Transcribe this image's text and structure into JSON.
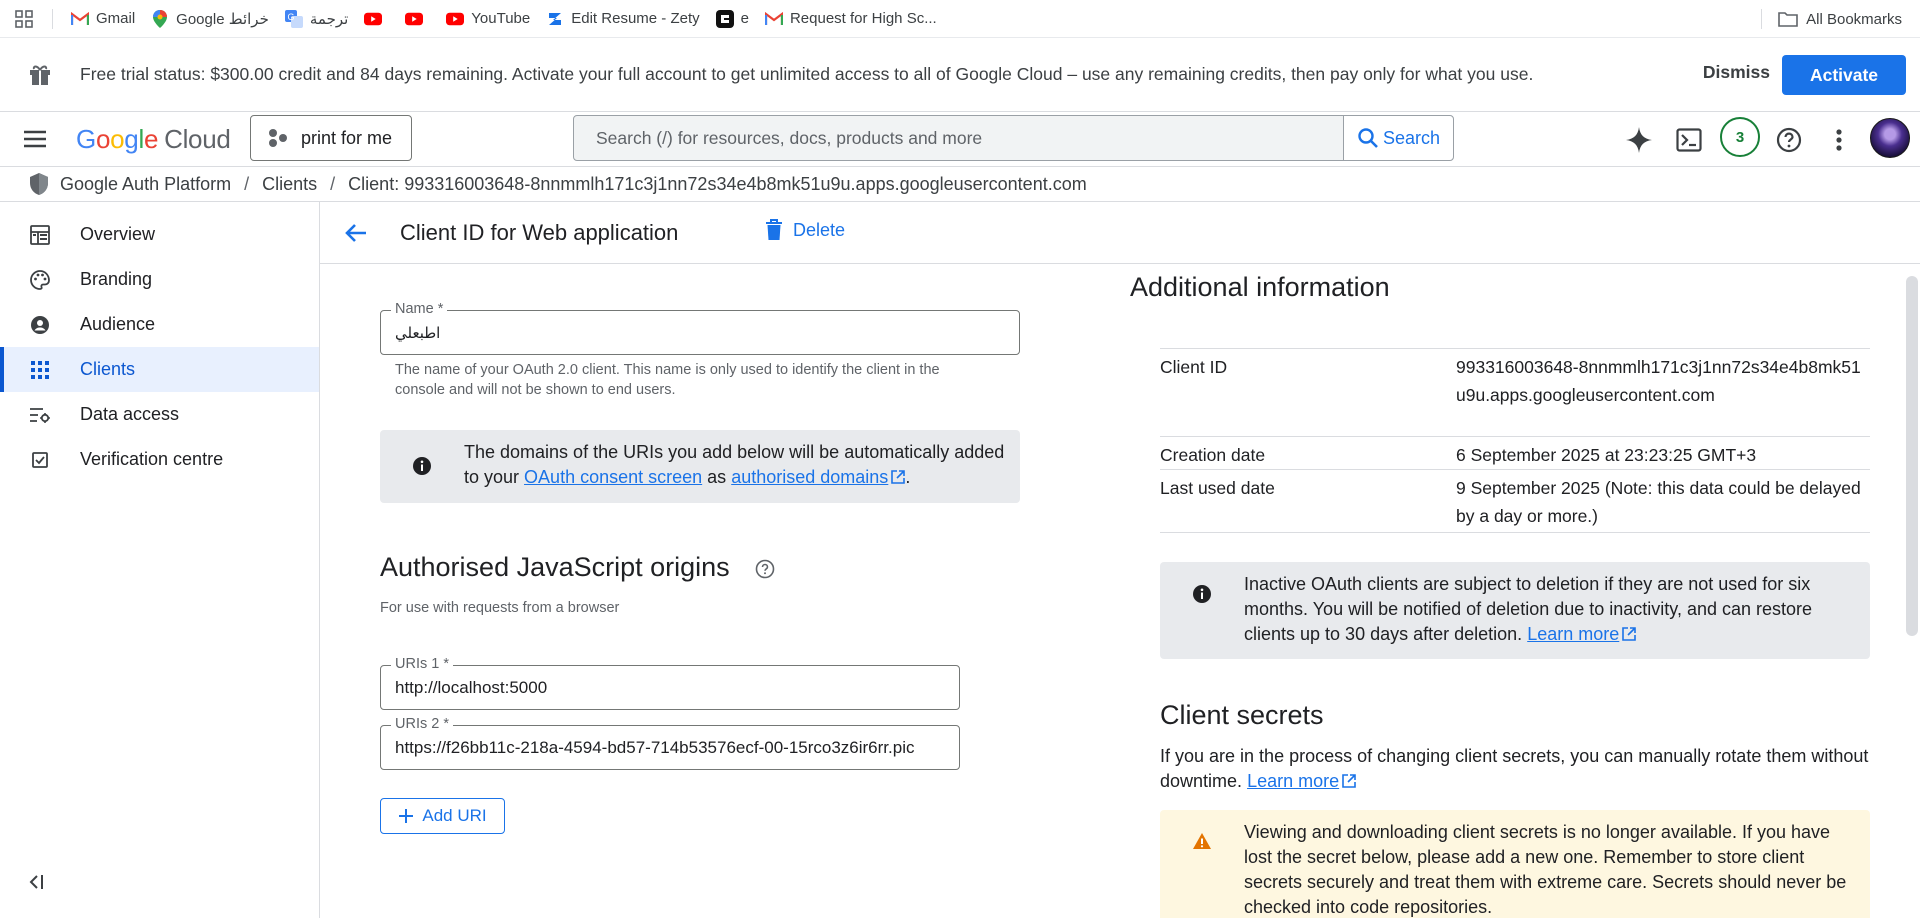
{
  "bookmarks": {
    "items": [
      {
        "label": "Gmail",
        "icon": "gmail-icon"
      },
      {
        "label": "Google خرائط",
        "icon": "maps-icon"
      },
      {
        "label": "ترجمة",
        "icon": "translate-icon"
      },
      {
        "label": "",
        "icon": "youtube-icon"
      },
      {
        "label": "",
        "icon": "youtube-icon"
      },
      {
        "label": "YouTube",
        "icon": "youtube-icon"
      },
      {
        "label": "Edit Resume - Zety",
        "icon": "zety-icon"
      },
      {
        "label": "e",
        "icon": "app-icon"
      },
      {
        "label": "Request for High Sc...",
        "icon": "gmail-icon"
      }
    ],
    "all_bookmarks": "All Bookmarks"
  },
  "trial": {
    "text": "Free trial status: $300.00 credit and 84 days remaining. Activate your full account to get unlimited access to all of Google Cloud – use any remaining credits, then pay only for what you use.",
    "dismiss": "Dismiss",
    "activate": "Activate"
  },
  "header": {
    "logo_google": "Google",
    "logo_cloud": "Cloud",
    "project": "print for me",
    "search_placeholder": "Search (/) for resources, docs, products and more",
    "search_button": "Search",
    "notifications_count": "3"
  },
  "breadcrumb": {
    "items": [
      "Google Auth Platform",
      "Clients",
      "Client: 993316003648-8nnmmlh171c3j1nn72s34e4b8mk51u9u.apps.googleusercontent.com"
    ],
    "separator": "/"
  },
  "sidebar": {
    "items": [
      {
        "label": "Overview",
        "icon": "dashboard-icon"
      },
      {
        "label": "Branding",
        "icon": "palette-icon"
      },
      {
        "label": "Audience",
        "icon": "person-icon"
      },
      {
        "label": "Clients",
        "icon": "grid-icon",
        "active": true
      },
      {
        "label": "Data access",
        "icon": "data-settings-icon"
      },
      {
        "label": "Verification centre",
        "icon": "checkbox-icon"
      }
    ]
  },
  "page": {
    "title": "Client ID for Web application",
    "delete_label": "Delete"
  },
  "form": {
    "name_label": "Name *",
    "name_value": "اطبعلي",
    "name_hint_1": "The name of your OAuth 2.0 client. This name is only used to identify the client in the",
    "name_hint_2": "console and will not be shown to end users.",
    "info_line1": "The domains of the URIs you add below will be automatically added",
    "info_to": "to your",
    "info_link1": "OAuth consent screen",
    "info_as": "as",
    "info_link2": "authorised domains",
    "info_end": ".",
    "js_origins_title": "Authorised JavaScript origins",
    "js_origins_hint": "For use with requests from a browser",
    "uri1_label": "URIs 1 *",
    "uri1_value": "http://localhost:5000",
    "uri2_label": "URIs 2 *",
    "uri2_value": "https://f26bb11c-218a-4594-bd57-714b53576ecf-00-15rco3z6ir6rr.pic",
    "add_uri": "Add URI"
  },
  "additional": {
    "title": "Additional information",
    "rows": [
      {
        "key": "Client ID",
        "value": "993316003648-8nnmmlh171c3j1nn72s34e4b8mk51u9u.apps.googleusercontent.com"
      },
      {
        "key": "Creation date",
        "value": "6 September 2025 at 23:23:25 GMT+3"
      },
      {
        "key": "Last used date",
        "value": "9 September 2025 (Note: this data could be delayed by a day or more.)"
      }
    ],
    "inactive_text": "Inactive OAuth clients are subject to deletion if they are not used for six months. You will be notified of deletion due to inactivity, and can restore clients up to 30 days after deletion.",
    "learn_more": "Learn more"
  },
  "secrets": {
    "title": "Client secrets",
    "text": "If you are in the process of changing client secrets, you can manually rotate them without downtime.",
    "learn_more": "Learn more",
    "warning": "Viewing and downloading client secrets is no longer available. If you have lost the secret below, please add a new one. Remember to store client secrets securely and treat them with extreme care. Secrets should never be checked into code repositories."
  },
  "colors": {
    "accent": "#1a73e8",
    "active_nav_bg": "#e8f0fe",
    "info_bg": "#e8eaed",
    "warning_bg": "#fef7e0",
    "warning_icon": "#e37400"
  }
}
